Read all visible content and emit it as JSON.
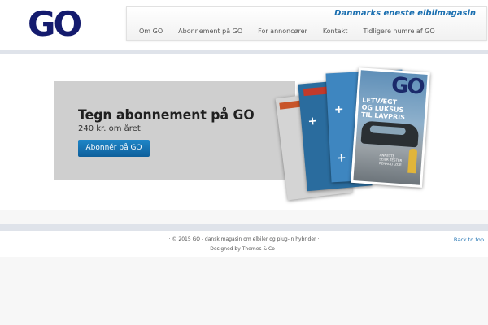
{
  "header": {
    "logo": "GO",
    "tagline": "Danmarks eneste elbilmagasin",
    "menu": [
      "Om GO",
      "Abonnement på GO",
      "For annoncører",
      "Kontakt",
      "Tidligere numre af GO"
    ]
  },
  "promo": {
    "title": "Tegn abonnement på GO",
    "price": "240 kr. om året",
    "button": "Abonnér på GO"
  },
  "magazine": {
    "logo": "GO",
    "headline": "LETVÆGT\nOG LUKSUS\nTIL LAVPRIS",
    "note": "ANNETTE\nSEIER TESTER\nRENAULT ZOE"
  },
  "footer": {
    "copyright": "· © 2015 GO - dansk magasin om elbiler og plug-in hybrider ·",
    "credit": "Designed by Themes & Co ·",
    "back_to_top": "Back to top"
  },
  "colors": {
    "brand_navy": "#141b6e",
    "link_blue": "#1a6fb0",
    "button_blue": "#1479bb",
    "promo_gray": "#cfcfcf"
  }
}
